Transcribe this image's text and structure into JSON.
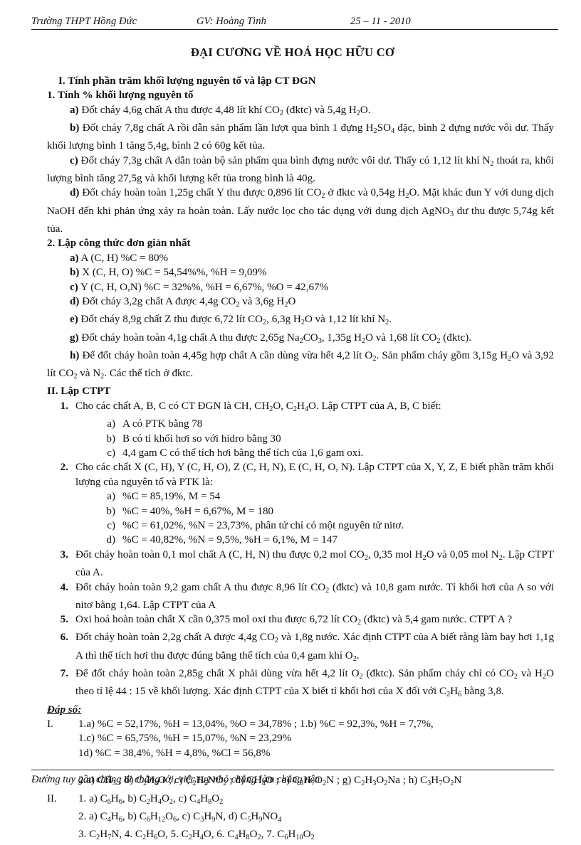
{
  "header": {
    "school": "Trường THPT Hồng Đức",
    "teacher": "GV: Hoàng Tình",
    "date": "25 – 11 - 2010"
  },
  "title": "ĐẠI CƯƠNG VỀ HOÁ HỌC HỮU CƠ",
  "section_1": {
    "heading": "I. Tính phần trăm khối lượng nguyên tố và lập CT ĐGN",
    "sub_1_heading": "1. Tính % khối lượng nguyên tố",
    "items": [
      {
        "label": "a)",
        "text": "Đốt cháy 4,6g chất A thu được 4,48 lít khí CO2 (đktc) và 5,4g H2O."
      },
      {
        "label": "b)",
        "text": "Đốt cháy 7,8g chất A rồi dẫn sản phẩm lần lượt qua bình 1 đựng H2SO4 đặc, bình 2 đựng nước vôi dư. Thấy khối lượng bình 1 tăng 5,4g, bình 2 có 60g kết tủa."
      },
      {
        "label": "c)",
        "text": "Đốt cháy 7,3g chất A dẫn toàn bộ sản phẩm qua bình đựng nước vôi dư. Thấy có 1,12 lít khí N2 thoát ra, khối lượng bình tăng 27,5g và khối lượng kết tủa trong bình là 40g."
      },
      {
        "label": "d)",
        "text": "Đốt cháy hoàn toàn 1,25g chất Y thu được 0,896 lít CO2 ở đktc và 0,54g H2O. Mặt khác đun Y với dung dịch NaOH đến khi phản ứng xảy ra hoàn toàn. Lấy nước lọc cho tác dụng với dung dịch AgNO3 dư thu được 5,74g kết tủa."
      }
    ],
    "sub_2_heading": "2. Lập công thức đơn giản nhất",
    "items2": [
      {
        "label": "a)",
        "text": "A (C, H) %C = 80%"
      },
      {
        "label": "b)",
        "text": "X (C, H, O) %C = 54,54%%, %H = 9,09%"
      },
      {
        "label": "c)",
        "text": "Y (C, H, O,N) %C = 32%%, %H = 6,67%, %O = 42,67%"
      },
      {
        "label": "d)",
        "text": "Đốt cháy 3,2g chất A được 4,4g CO2 và 3,6g H2O"
      },
      {
        "label": "e)",
        "text": "Đốt cháy 8,9g chất Z thu được 6,72 lít CO2, 6,3g H2O và 1,12 lít khí N2."
      },
      {
        "label": "g)",
        "text": "Đốt cháy hoàn toàn 4,1g chất A thu được 2,65g Na2CO3, 1,35g H2O và 1,68 lít CO2 (đktc)."
      },
      {
        "label": "h)",
        "text": "Để đốt cháy hoàn toàn 4,45g hợp chất A cần dùng vừa hết 4,2 lít O2. Sản phẩm cháy gồm 3,15g H2O và 3,92 lít CO2 và N2. Các thể tích ở đktc."
      }
    ]
  },
  "section_2": {
    "heading": "II. Lập CTPT",
    "items": [
      {
        "num": "1.",
        "text": "Cho các chất A, B, C có CT ĐGN là CH, CH2O, C2H4O. Lập CTPT của A, B, C biết:",
        "sub": [
          {
            "label": "a)",
            "text": "A có PTK bằng 78"
          },
          {
            "label": "b)",
            "text": "B có tỉ khối hơi so với hidro bằng 30"
          },
          {
            "label": "c)",
            "text": "4,4 gam C có thể tích hơi bằng thể tích của 1,6 gam oxi."
          }
        ]
      },
      {
        "num": "2.",
        "text": "Cho các chất X (C, H), Y (C, H, O), Z (C, H, N), E (C, H, O, N). Lập CTPT của X, Y, Z, E biết phần trăm khối lượng của nguyên tố và PTK là:",
        "sub": [
          {
            "label": "a)",
            "text": "%C = 85,19%, M = 54"
          },
          {
            "label": "b)",
            "text": "%C = 40%, %H = 6,67%, M = 180"
          },
          {
            "label": "c)",
            "text": "%C = 61,02%, %N = 23,73%, phân tử chỉ có một nguyên tử nitơ."
          },
          {
            "label": "d)",
            "text": "%C = 40,82%, %N = 9,5%, %H = 6,1%, M = 147"
          }
        ]
      },
      {
        "num": "3.",
        "text": "Đốt cháy hoàn toàn 0,1 mol chất A (C, H, N) thu được 0,2 mol CO2, 0,35 mol H2O và 0,05 mol N2. Lập CTPT của A.",
        "sub": []
      },
      {
        "num": "4.",
        "text": "Đốt cháy hoàn toàn 9,2 gam chất A thu được 8,96 lít CO2 (đktc) và 10,8 gam nước. Tỉ khối hơi của A so với nitơ bằng 1,64. Lập CTPT của A",
        "sub": []
      },
      {
        "num": "5.",
        "text": "Oxi hoá hoàn toàn chất X cần 0,375 mol oxi thu được 6,72 lít CO2 (đktc) và 5,4 gam nước. CTPT A ?",
        "sub": []
      },
      {
        "num": "6.",
        "text": "Đốt cháy hoàn toàn 2,2g chất A được 4,4g CO2 và 1,8g nước. Xác định CTPT của A biết rằng làm bay hơi 1,1g A thì thể tích hơi thu được đúng bằng thể tích của 0,4 gam khí O2.",
        "sub": []
      },
      {
        "num": "7.",
        "text": "Để đốt cháy hoàn toàn 2,85g chất X phải dùng vừa hết 4,2 lít O2 (đktc). Sản phẩm cháy chỉ có CO2 và H2O theo tỉ lệ 44 : 15 về khối lượng. Xác định CTPT của X biết tỉ khối hơi của X đối với C2H6 bằng 3,8.",
        "sub": []
      }
    ]
  },
  "answers": {
    "heading": "Đáp số:",
    "rows": [
      {
        "rnum": "I.",
        "text": "1.a) %C = 52,17%, %H = 13,04%, %O = 34,78% ; 1.b) %C = 92,3%, %H = 7,7%,"
      },
      {
        "rnum": "",
        "text": "1.c) %C = 65,75%, %H = 15,07%, %N = 23,29%"
      },
      {
        "rnum": "",
        "text": "1d) %C = 38,4%, %H = 4,8%, %Cl = 56,8%"
      },
      {
        "rnum": "",
        "text": "2.a) CH3 ; b) C2H4O ; c) C2H5NO2 ; d) CH4O ; e) C3H7O2N ; g) C2H3O2Na ; h) C3H7O2N",
        "gap_before": true
      },
      {
        "rnum": "II.",
        "text": "1. a) C6H6, b) C2H4O2, c) C4H8O2"
      },
      {
        "rnum": "",
        "text": "2. a) C4H6, b) C6H12O6, c) C3H9N, d) C5H9NO4"
      },
      {
        "rnum": "",
        "text": "3. C2H7N, 4. C2H6O, 5. C2H4O, 6. C4H8O2, 7. C6H10O2"
      }
    ]
  },
  "footer": "Đường tuy gần chẳng đi chẳng tới, việc tuy nhỏ chẳng làm chẳng nên"
}
